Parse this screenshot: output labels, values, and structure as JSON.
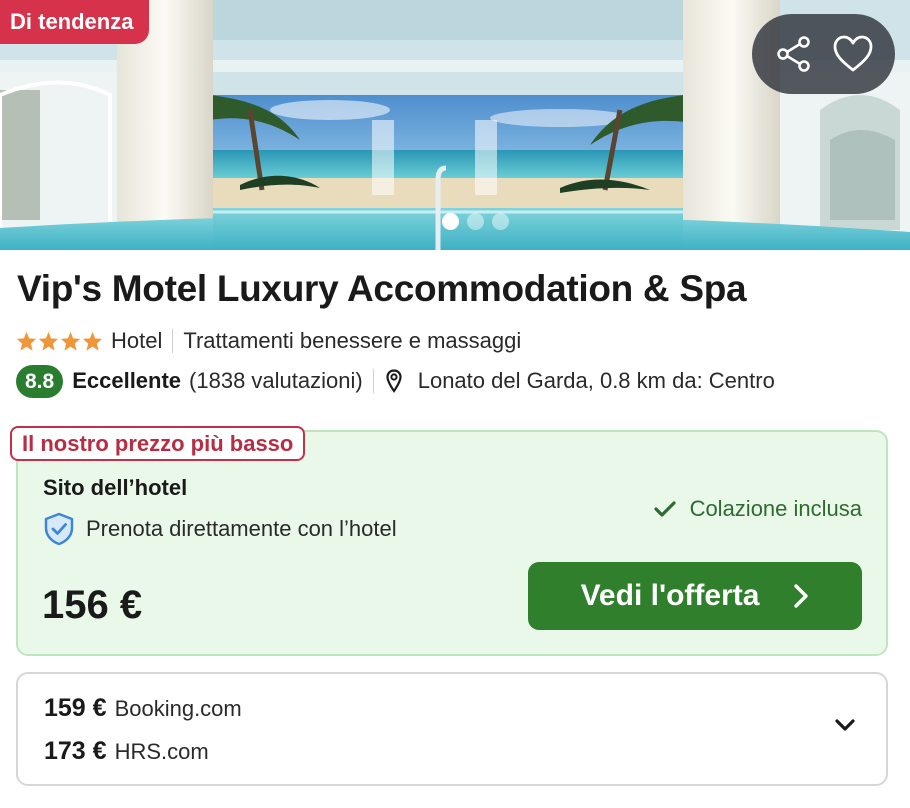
{
  "hero": {
    "badge": "Di tendenza",
    "photo_count": 3,
    "active_photo": 1,
    "share_icon": "share-icon",
    "favorite_icon": "heart-outline-icon"
  },
  "hotel": {
    "name": "Vip's Motel Luxury Accommodation & Spa",
    "stars": 4,
    "type": "Hotel",
    "feature": "Trattamenti benessere e massaggi",
    "score": "8.8",
    "rating_word": "Eccellente",
    "reviews": "(1838 valutazioni)",
    "location": "Lonato del Garda, 0.8 km da: Centro"
  },
  "deal": {
    "badge": "Il nostro prezzo più basso",
    "provider": "Sito dell’hotel",
    "direct_label": "Prenota direttamente con l’hotel",
    "amenity": "Colazione inclusa",
    "price": "156 €",
    "cta_label": "Vedi l'offerta"
  },
  "other_offers": [
    {
      "price": "159 €",
      "provider": "Booking.com"
    },
    {
      "price": "173 €",
      "provider": "HRS.com"
    }
  ],
  "colors": {
    "badge_red": "#d7324b",
    "score_green": "#2a7d2e",
    "deal_bg": "#eaf8ea",
    "deal_border": "#bfe5c0",
    "cta_green": "#2f7f2c",
    "star_orange": "#f0963a"
  }
}
